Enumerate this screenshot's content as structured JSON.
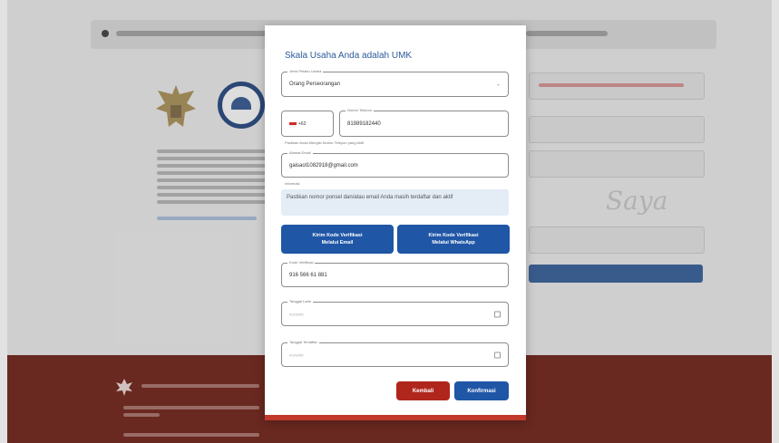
{
  "modal": {
    "title": "Skala Usaha Anda adalah UMK",
    "fields": {
      "business_type_label": "Jenis Pelaku Usaha",
      "business_type_value": "Orang Perseorangan",
      "phone_country_code": "+62",
      "phone_label": "Nomor Telepon",
      "phone_value": "81989182440",
      "phone_hint": "Pastikan Anda Mengisi Nomor Telepon yang Aktif",
      "email_label": "Alamat Email",
      "email_value": "gaisaol1082918@gmail.com",
      "info_label": "Informasi",
      "info_text": "Pastikan nomor ponsel dan/atau email Anda masih terdaftar dan aktif",
      "verification_code_label": "Kode Verifikasi",
      "verification_code_value": "916 566 61 881",
      "date1_label": "Tanggal Lahir",
      "date1_placeholder": "hh/bb/tttt",
      "date2_label": "Tanggal Terdaftar",
      "date2_placeholder": "hh/bb/tttt"
    },
    "buttons": {
      "email_verify_line1": "Kirim Kode Verifikasi",
      "email_verify_line2": "Melalui Email",
      "whatsapp_verify_line1": "Kirim Kode Verifikasi",
      "whatsapp_verify_line2": "Melalui WhatsApp",
      "back": "Kembali",
      "confirm": "Konfirmasi"
    }
  },
  "colors": {
    "primary": "#1f56a6",
    "danger": "#b0261c",
    "footer": "#6e2a22",
    "title": "#2b5b9a"
  },
  "icons": [
    "emblem-icon",
    "circle-logo-icon",
    "chevron-down-icon",
    "calendar-icon",
    "indonesia-flag-icon",
    "footer-logo-icon"
  ]
}
